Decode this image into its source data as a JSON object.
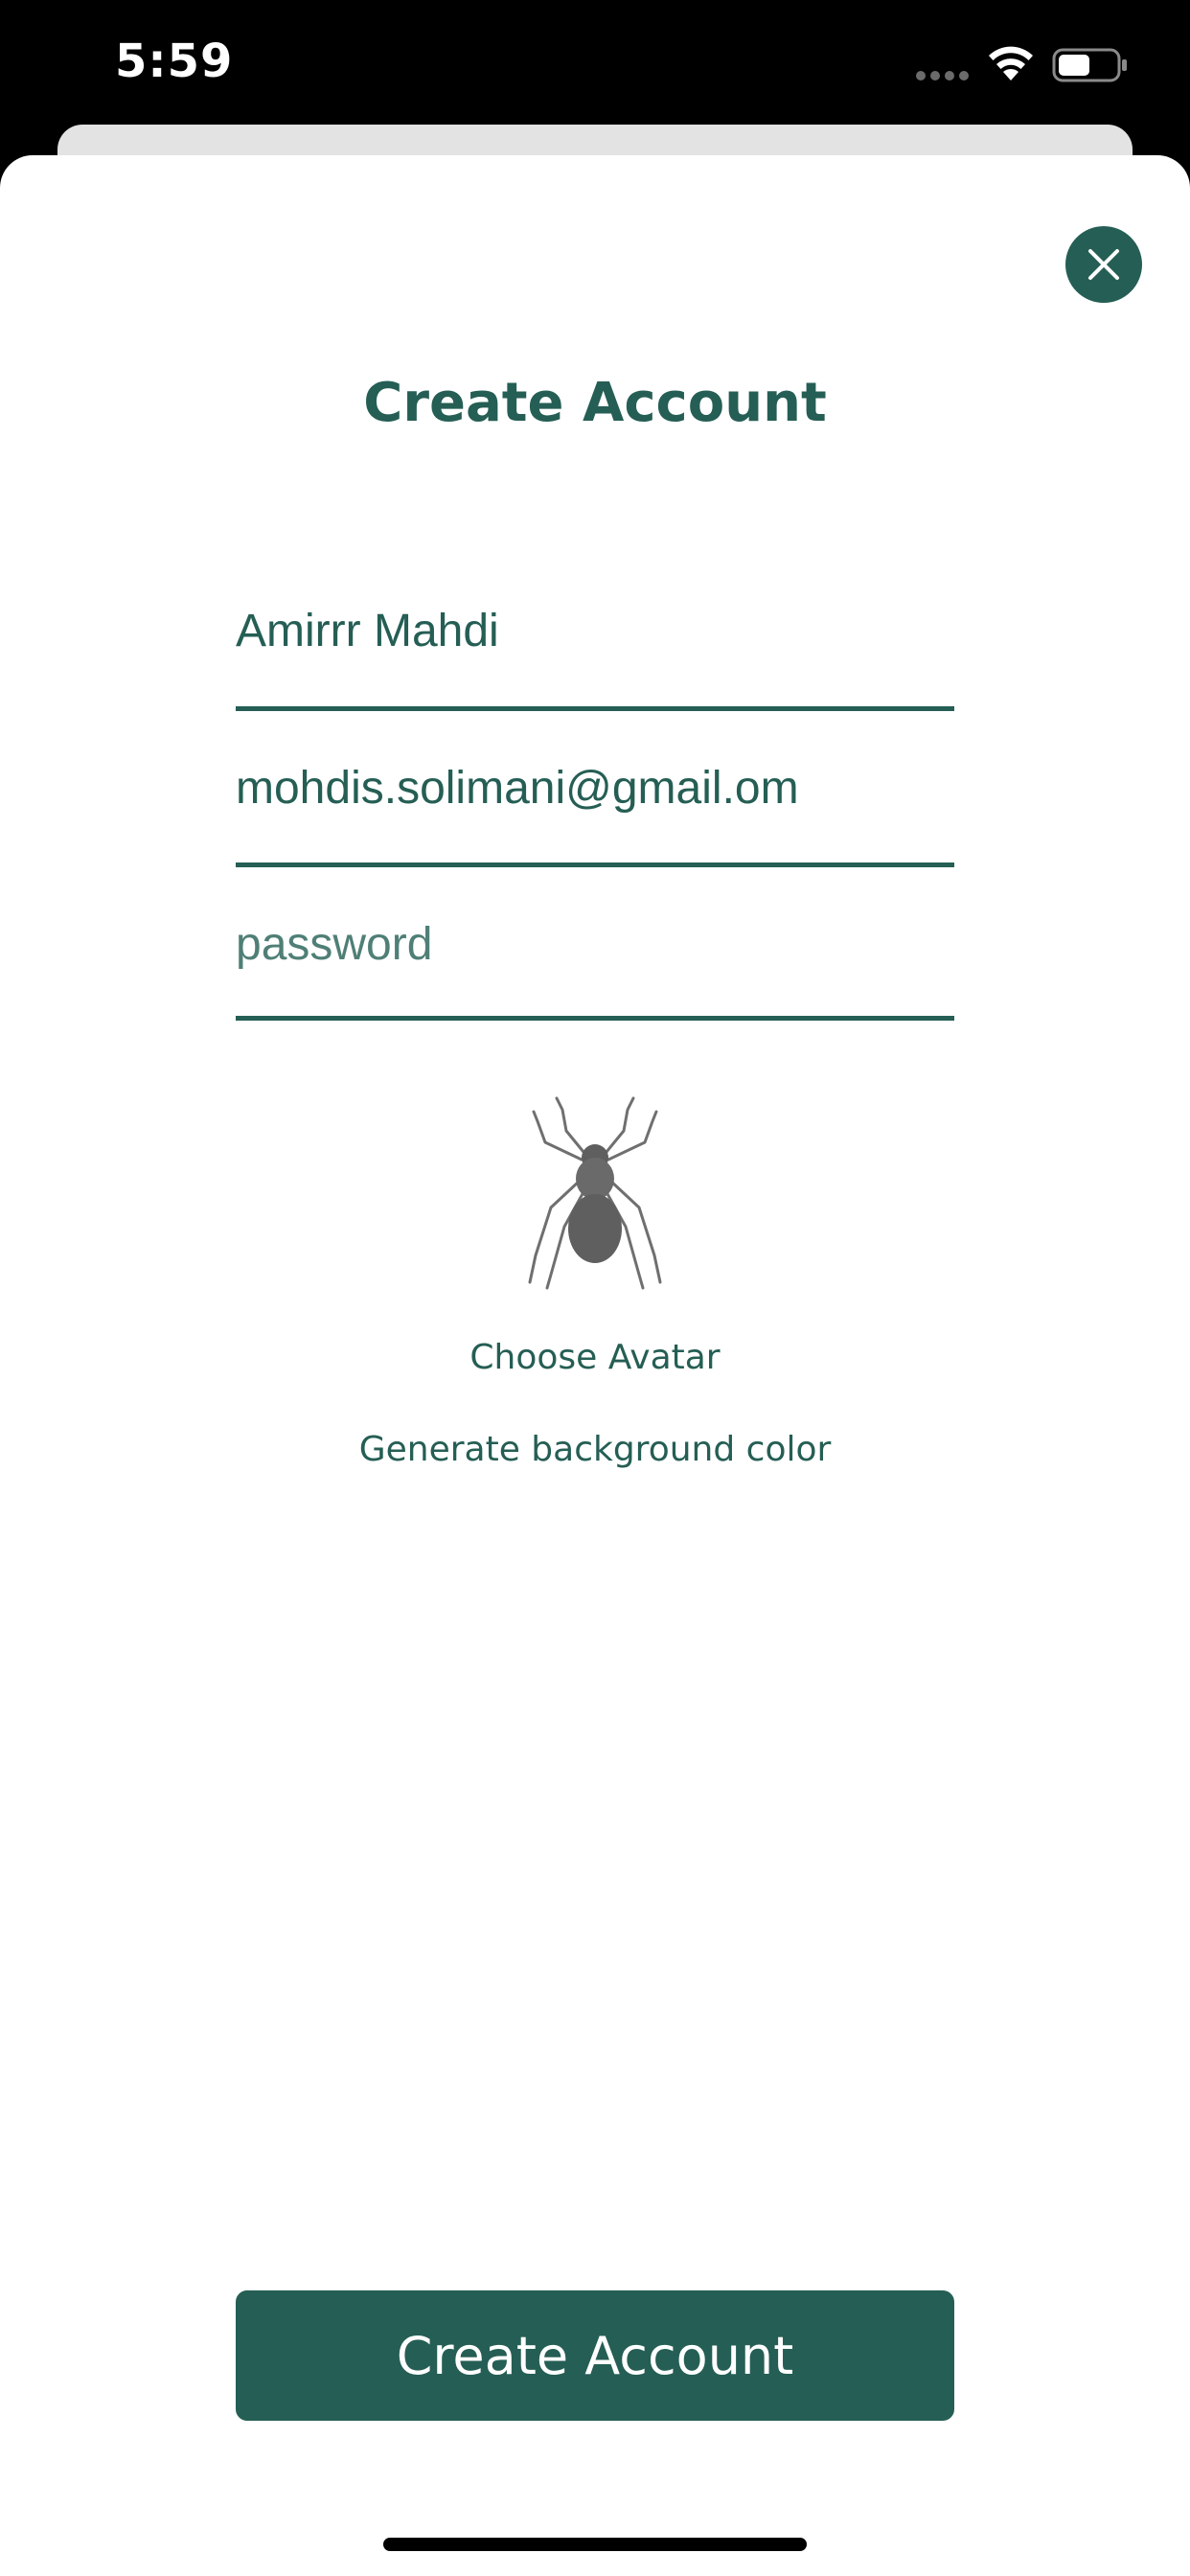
{
  "status_bar": {
    "time": "5:59",
    "icons": [
      "signal-dots-icon",
      "wifi-icon",
      "battery-icon"
    ],
    "battery_level": 0.55
  },
  "header": {
    "close_icon": "close-icon",
    "title": "Create Account"
  },
  "form": {
    "name_value": "Amirrr Mahdi",
    "email_value": "mohdis.solimani@gmail.om",
    "password_value": "",
    "password_placeholder": "password"
  },
  "avatar": {
    "icon": "spider-icon",
    "choose_label": "Choose Avatar",
    "generate_label": "Generate background color"
  },
  "footer": {
    "submit_label": "Create Account"
  },
  "colors": {
    "accent": "#255e54",
    "background": "#ffffff",
    "status_bar": "#000000"
  }
}
